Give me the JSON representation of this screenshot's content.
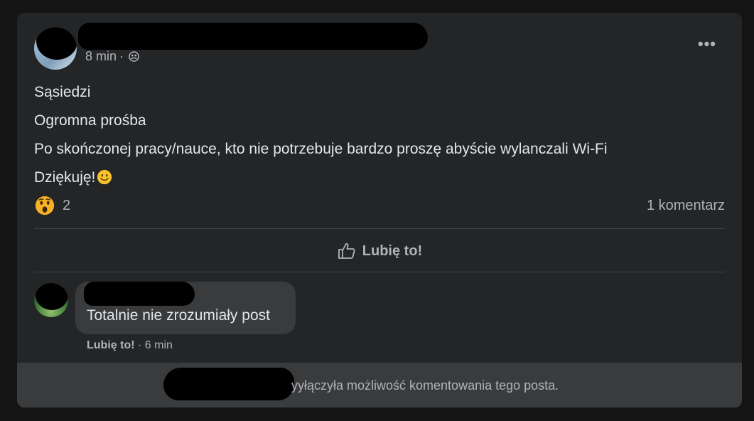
{
  "post": {
    "time": "8 min",
    "separator": "·",
    "privacy_icon": "group-icon",
    "more_icon": "more-options-icon",
    "more_label": "•••",
    "lines": [
      "Sąsiedzi",
      "Ogromna prośba",
      "Po skończonej pracy/nauce, kto nie potrzebuje bardzo proszę abyście wylanczali Wi-Fi",
      "Dziękuję!"
    ],
    "emoji_after_last_line": "smiling-face-emoji",
    "reaction_icon": "wow-reaction-icon",
    "reaction_count": "2",
    "comment_count": "1 komentarz"
  },
  "actions": {
    "like_label": "Lubię to!"
  },
  "comment": {
    "text": "Totalnie nie zrozumiały post",
    "like_label": "Lubię to!",
    "separator": "·",
    "time": "6 min"
  },
  "footer": {
    "text": "yyłączyła możliwość komentowania tego posta."
  },
  "colors": {
    "background": "#141415",
    "card": "#242526",
    "bubble": "#3a3b3c",
    "text_primary": "#e4e6eb",
    "text_secondary": "#b0b3b8",
    "reaction_yellow": "#f7b125"
  }
}
